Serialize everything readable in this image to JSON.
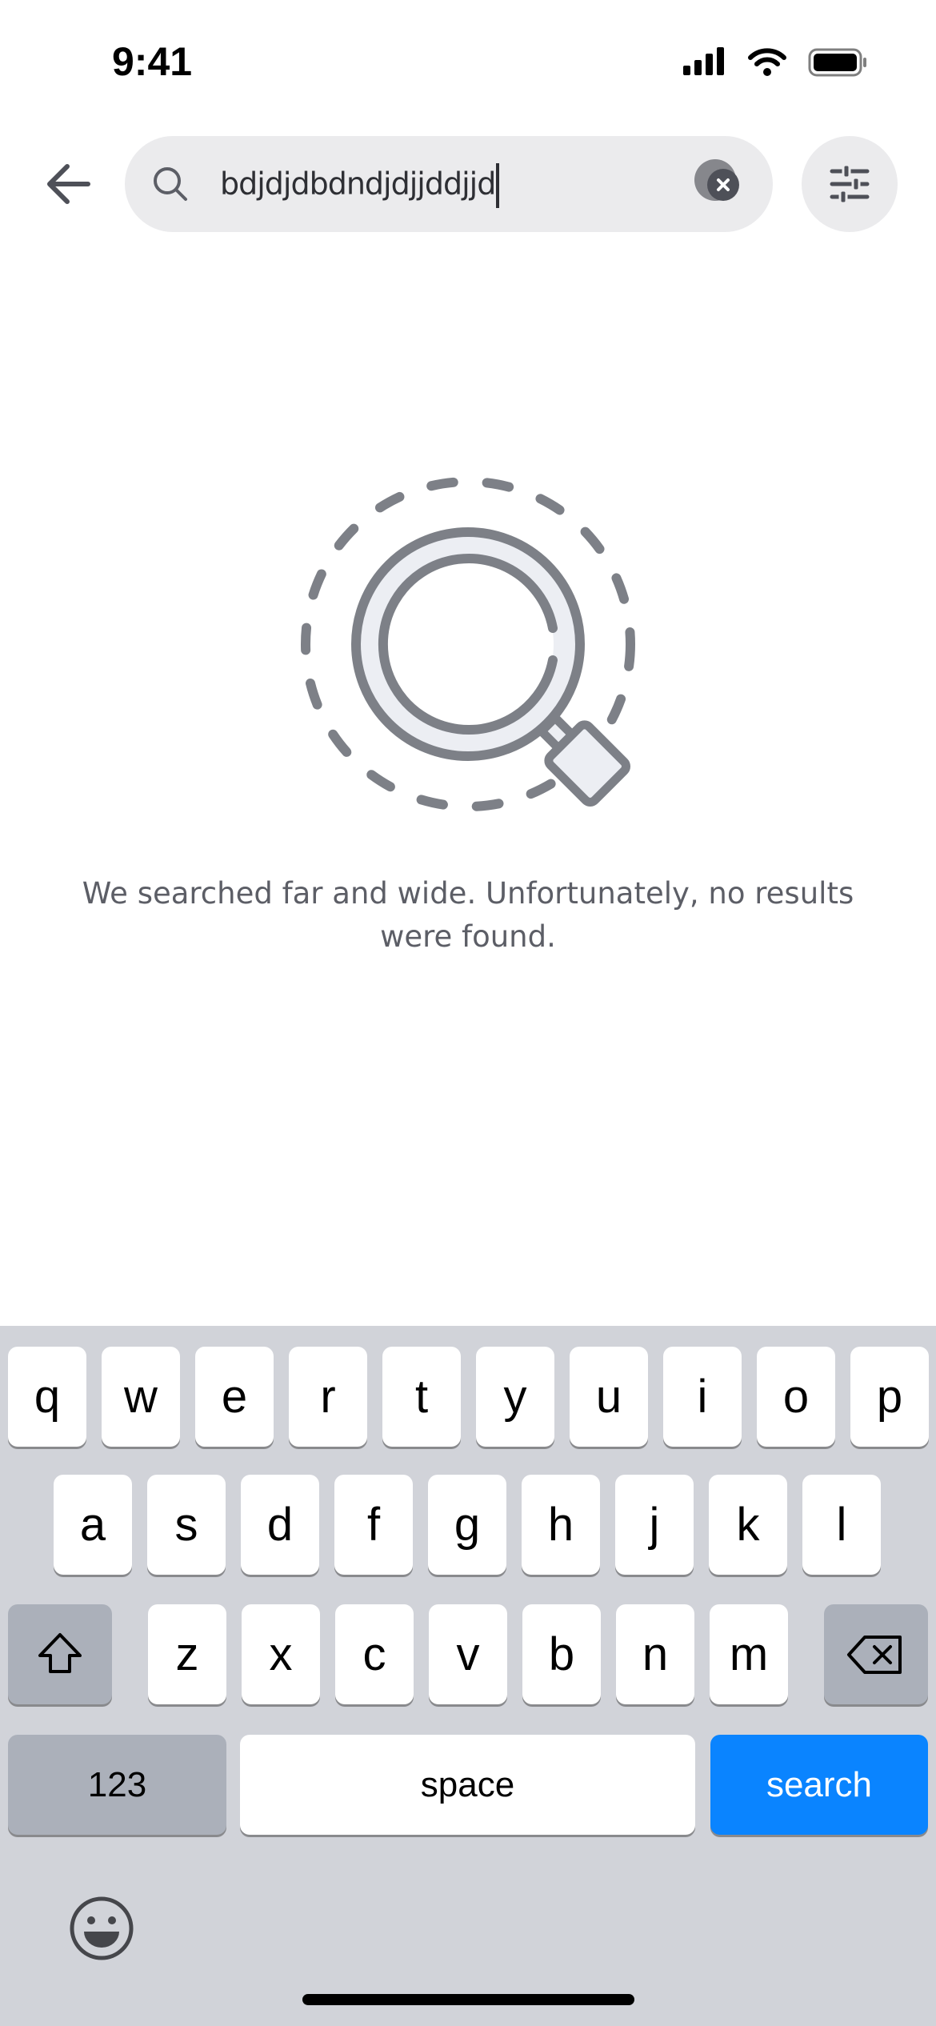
{
  "status_bar": {
    "time": "9:41"
  },
  "search": {
    "query": "bdjdjdbdndjdjjddjjd"
  },
  "empty_state": {
    "message": "We searched far and wide. Unfortunately, no results were found."
  },
  "colors": {
    "accent": "#0a84ff",
    "illustration": "#7d8087",
    "pill": "#ebebed"
  },
  "keyboard": {
    "row1": [
      "q",
      "w",
      "e",
      "r",
      "t",
      "y",
      "u",
      "i",
      "o",
      "p"
    ],
    "row2": [
      "a",
      "s",
      "d",
      "f",
      "g",
      "h",
      "j",
      "k",
      "l"
    ],
    "row3": [
      "z",
      "x",
      "c",
      "v",
      "b",
      "n",
      "m"
    ],
    "numbers_label": "123",
    "space_label": "space",
    "search_label": "search"
  }
}
